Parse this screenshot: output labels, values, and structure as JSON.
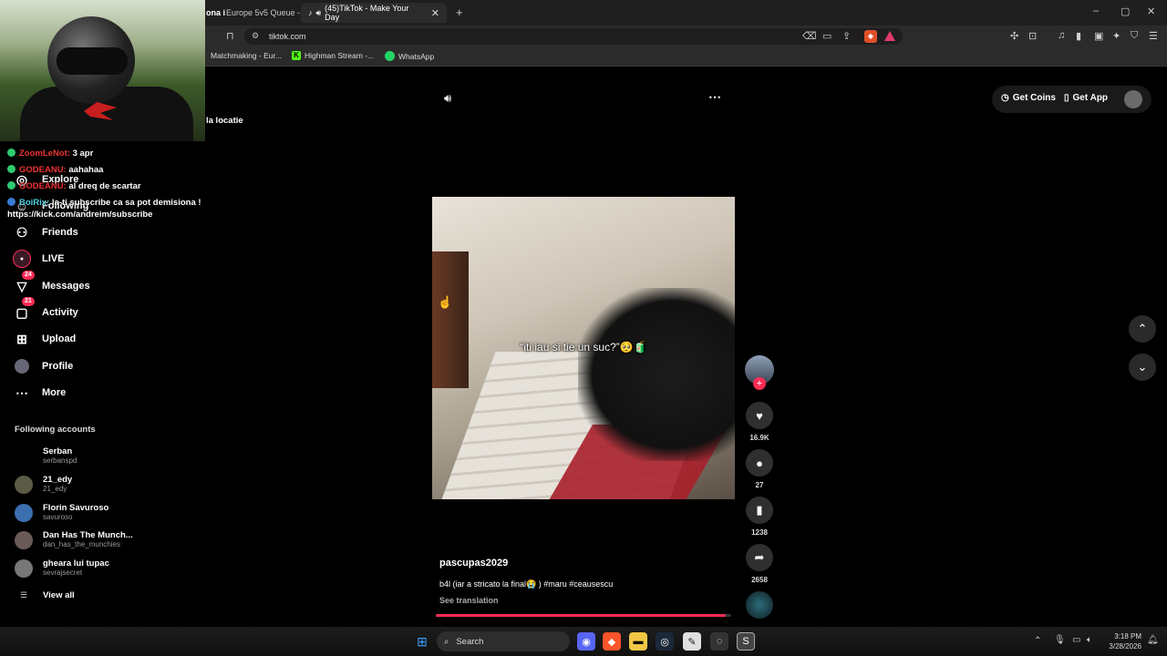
{
  "browser": {
    "tabs": [
      {
        "label": "ona i",
        "partial": true
      },
      {
        "label": "Europe 5v5 Queue -"
      },
      {
        "label": "(45)TikTok - Make Your Day",
        "active": true
      }
    ],
    "url": "tiktok.com",
    "bookmarks": [
      "Matchmaking - Eur...",
      "Highman Stream -...",
      "WhatsApp"
    ],
    "window_controls": [
      "–",
      "▢",
      "✕"
    ]
  },
  "overlay": {
    "top_text": "la locatie",
    "chat": [
      {
        "user": "ZoomLeNot:",
        "text": "3 apr"
      },
      {
        "user": "GODEANU:",
        "text": "aahahaa"
      },
      {
        "user": "GODEANU:",
        "text": "al dreq de scartar"
      },
      {
        "user": "BoiRix:",
        "text": "la-ti subscribe ca sa pot demisiona !"
      }
    ],
    "link": "https://kick.com/andreim/subscribe"
  },
  "sidebar": {
    "nav": [
      {
        "label": "Explore",
        "icon": "compass-icon"
      },
      {
        "label": "Following",
        "icon": "following-icon"
      },
      {
        "label": "Friends",
        "icon": "friends-icon"
      },
      {
        "label": "LIVE",
        "icon": "live-icon"
      },
      {
        "label": "Messages",
        "icon": "messages-icon",
        "badge": "24"
      },
      {
        "label": "Activity",
        "icon": "activity-icon",
        "badge": "21"
      },
      {
        "label": "Upload",
        "icon": "upload-icon"
      },
      {
        "label": "Profile",
        "icon": "profile-icon"
      },
      {
        "label": "More",
        "icon": "more-icon"
      }
    ],
    "following_title": "Following accounts",
    "accounts": [
      {
        "name": "Serban",
        "handle": "serbanspd"
      },
      {
        "name": "21_edy",
        "handle": "21_edy"
      },
      {
        "name": "Florin Savuroso",
        "handle": "savuroso"
      },
      {
        "name": "Dan Has The Munch...",
        "handle": "dan_has_the_munchies"
      },
      {
        "name": "gheara lui tupac",
        "handle": "sevrajsecret"
      }
    ],
    "view_all": "View all"
  },
  "header": {
    "get_coins": "Get Coins",
    "get_app": "Get App"
  },
  "video": {
    "caption": "“iti iau si tie un suc?”🥺🧃",
    "author": "pascupas2029",
    "description": "b4l (iar a stricato la final😭 ) #maru #ceausescu",
    "see_translation": "See translation",
    "progress_fraction": 0.98
  },
  "actions": {
    "likes": "16.9K",
    "comments": "27",
    "saves": "1238",
    "shares": "2658"
  },
  "taskbar": {
    "search": "Search",
    "time": "3:18 PM",
    "date": "3/28/2026"
  },
  "colors": {
    "accent": "#fe2c55",
    "background": "#000000"
  }
}
